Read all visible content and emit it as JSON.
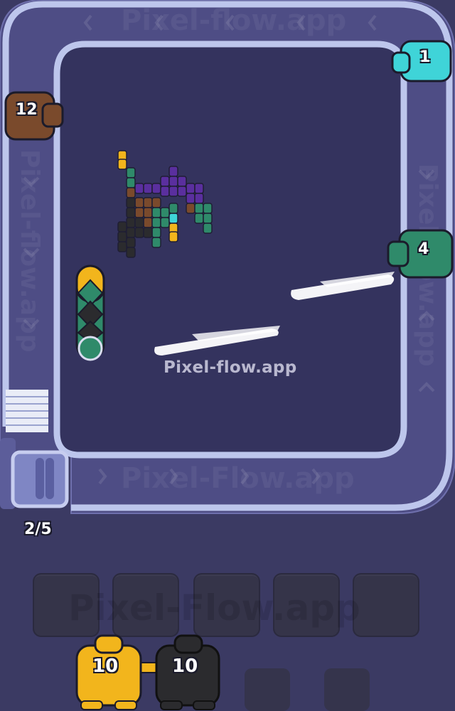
{
  "watermark": {
    "center": "Pixel-flow.app",
    "top": "Pixel-flow.app",
    "bottom_belt": "Pixel-Flow.app",
    "slots": "Pixel-Flow.app",
    "left": "Pixel-flow.app",
    "right": "Pixel-flow.app"
  },
  "belt_shooters": [
    {
      "count": "1",
      "color": "#3fd4d8",
      "position": "top-right"
    },
    {
      "count": "12",
      "color": "#7a4a2c",
      "position": "left-top"
    },
    {
      "count": "4",
      "color": "#2f8a6a",
      "position": "right-middle"
    }
  ],
  "belt_capacity": {
    "label": "2/5",
    "used": 2,
    "total": 5
  },
  "holding_slots": {
    "count": 5
  },
  "queue": [
    {
      "count": "10",
      "color": "#f2b51c"
    },
    {
      "count": "10",
      "color": "#2b2b2e"
    }
  ],
  "board_colors": {
    "purple": "#5a2f9e",
    "brown": "#7a4a2c",
    "teal": "#2f8a6a",
    "cyan": "#3fd4d8",
    "black": "#2b2b2e",
    "yellow": "#f2b51c"
  }
}
